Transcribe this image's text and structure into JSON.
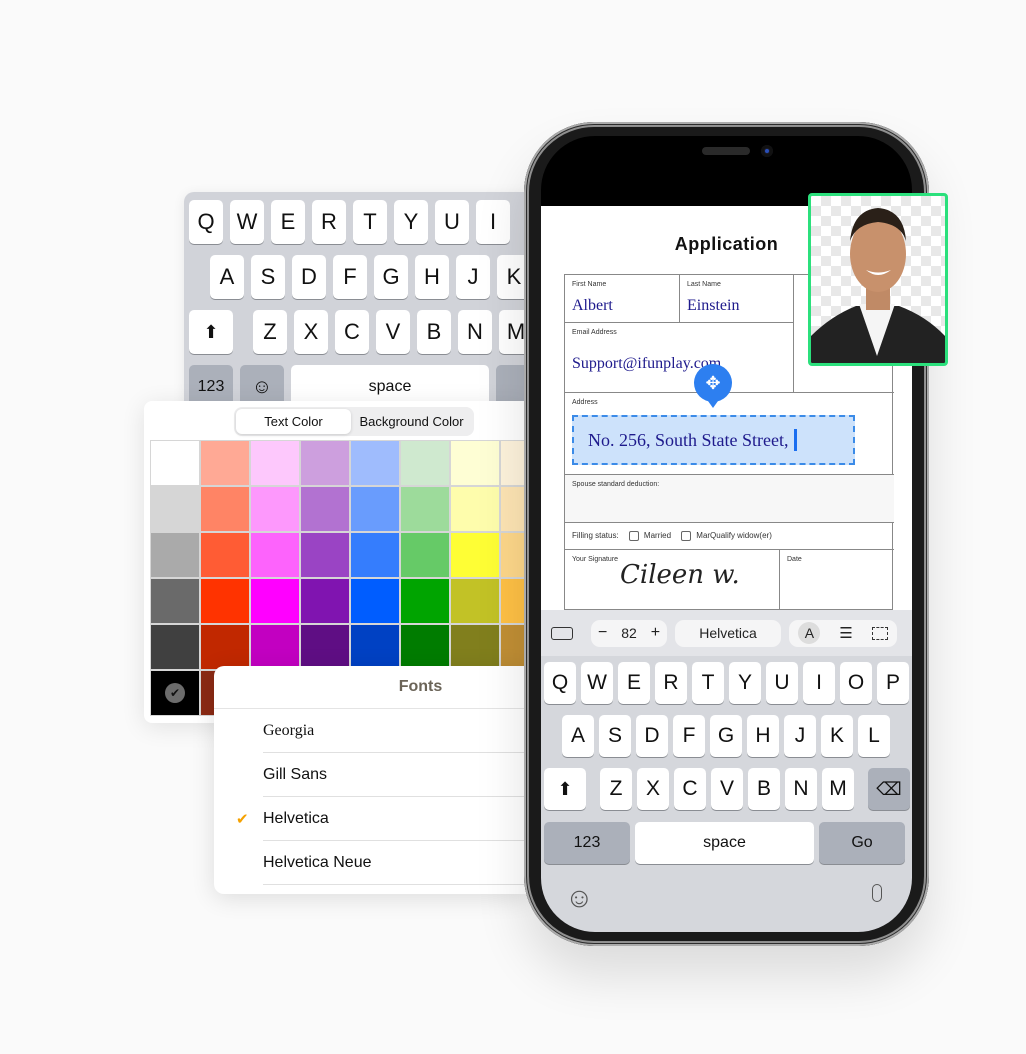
{
  "back_keyboard": {
    "row1": [
      "Q",
      "W",
      "E",
      "R",
      "T",
      "Y",
      "U",
      "I"
    ],
    "row2": [
      "A",
      "S",
      "D",
      "F",
      "G",
      "H",
      "J",
      "K"
    ],
    "row3": [
      "Z",
      "X",
      "C",
      "V",
      "B",
      "N",
      "M"
    ],
    "numbers_label": "123",
    "space_label": "space"
  },
  "color_panel": {
    "tabs": [
      {
        "label": "Text Color",
        "active": true
      },
      {
        "label": "Background Color",
        "active": false
      }
    ],
    "swatches": [
      [
        "#ffffff",
        "#ffa995",
        "#fdc8fc",
        "#cd9fde",
        "#9fbcfd",
        "#cfe9cf",
        "#fefed4",
        "#fef3dc"
      ],
      [
        "#d6d6d6",
        "#ff8465",
        "#fd98fc",
        "#b272d1",
        "#699cfd",
        "#9ddb9b",
        "#fefdac",
        "#fee5b4"
      ],
      [
        "#aaaaaa",
        "#ff5c34",
        "#fd63fc",
        "#9a44c4",
        "#357dfd",
        "#66ca67",
        "#fefe35",
        "#fed88a"
      ],
      [
        "#6a6a6a",
        "#ff3300",
        "#ff00ff",
        "#8014b0",
        "#005dff",
        "#00a400",
        "#c2c226",
        "#ffc145"
      ],
      [
        "#404040",
        "#c12800",
        "#c200c1",
        "#5f0e84",
        "#0041c3",
        "#007c00",
        "#817f1d",
        "#c18f35"
      ],
      [
        "#000000",
        "#8b2a14",
        "",
        "",
        "",
        "",
        "",
        ""
      ]
    ],
    "selected_swatch": "#000000"
  },
  "fonts_panel": {
    "title": "Fonts",
    "items": [
      {
        "label": "Georgia",
        "selected": false
      },
      {
        "label": "Gill Sans",
        "selected": false
      },
      {
        "label": "Helvetica",
        "selected": true
      },
      {
        "label": "Helvetica Neue",
        "selected": false
      }
    ]
  },
  "document": {
    "title": "Application",
    "first_name_label": "First Name",
    "first_name": "Albert",
    "last_name_label": "Last Name",
    "last_name": "Einstein",
    "email_label": "Email Address",
    "email": "Support@ifunplay.com",
    "address_label": "Address",
    "address": "No. 256, South State Street,",
    "spouse_label": "Spouse standard deduction:",
    "filing_label": "Filling status:",
    "filing_options": [
      "Married",
      "MarQualify widow(er)"
    ],
    "signature_label": "Your Signature",
    "signature": "Cileen w.",
    "date_label": "Date"
  },
  "toolbar": {
    "font_size": "82",
    "font_name": "Helvetica",
    "minus": "−",
    "plus": "+",
    "color_label": "A"
  },
  "keyboard": {
    "row1": [
      "Q",
      "W",
      "E",
      "R",
      "T",
      "Y",
      "U",
      "I",
      "O",
      "P"
    ],
    "row2": [
      "A",
      "S",
      "D",
      "F",
      "G",
      "H",
      "J",
      "K",
      "L"
    ],
    "row3": [
      "Z",
      "X",
      "C",
      "V",
      "B",
      "N",
      "M"
    ],
    "numbers_label": "123",
    "space_label": "space",
    "go_label": "Go"
  },
  "colors": {
    "accent_blue": "#2d7ff0",
    "selection_green": "#2be07c",
    "field_text": "#1e1a8c",
    "checkmark_orange": "#f5a100"
  }
}
